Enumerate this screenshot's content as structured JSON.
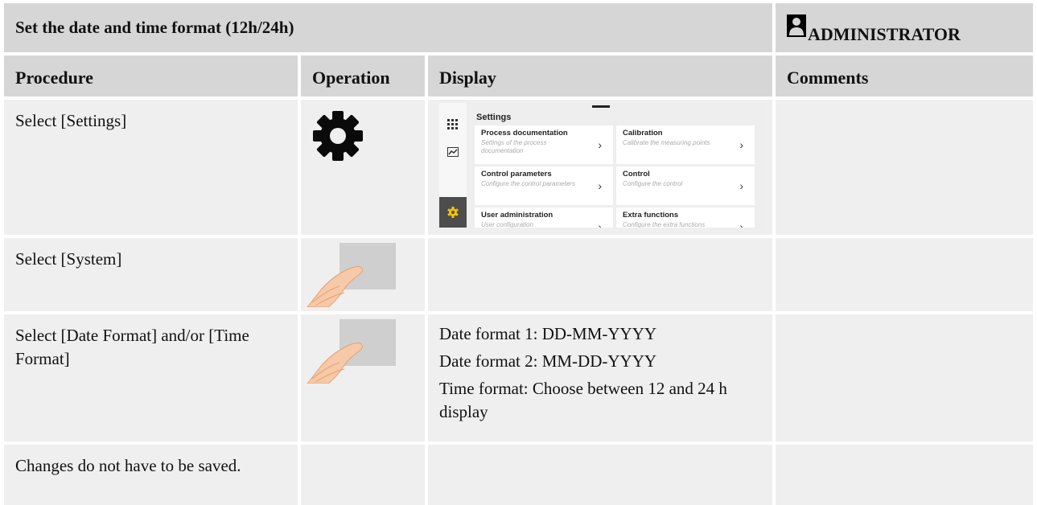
{
  "header": {
    "title": "Set the date and time format (12h/24h)",
    "role": "ADMINISTRATOR"
  },
  "columns": [
    "Procedure",
    "Operation",
    "Display",
    "Comments"
  ],
  "rows": [
    {
      "procedure": "Select [Settings]",
      "operation_icon": "gear-icon"
    },
    {
      "procedure": "Select [System]",
      "operation_icon": "finger-tap-icon"
    },
    {
      "procedure": "Select [Date Format] and/or [Time Format]",
      "operation_icon": "finger-tap-icon",
      "display_lines": [
        "Date format 1: DD-MM-YYYY",
        "Date format 2: MM-DD-YYYY",
        "Time format: Choose between 12 and 24 h display"
      ]
    },
    {
      "procedure": "Changes do not have to be saved."
    }
  ],
  "settings_screen": {
    "title": "Settings",
    "tiles": [
      {
        "title": "Process documentation",
        "subtitle": "Settings of the process documentation"
      },
      {
        "title": "Calibration",
        "subtitle": "Calibrate the measuring points"
      },
      {
        "title": "Control parameters",
        "subtitle": "Configure the control parameters"
      },
      {
        "title": "Control",
        "subtitle": "Configure the control"
      },
      {
        "title": "User administration",
        "subtitle": "User configuration"
      },
      {
        "title": "Extra functions",
        "subtitle": "Configure the extra functions"
      }
    ],
    "sidebar_icons": [
      "apps-grid-icon",
      "chart-icon",
      "settings-gear-icon"
    ],
    "active_color": "#f2c200"
  }
}
